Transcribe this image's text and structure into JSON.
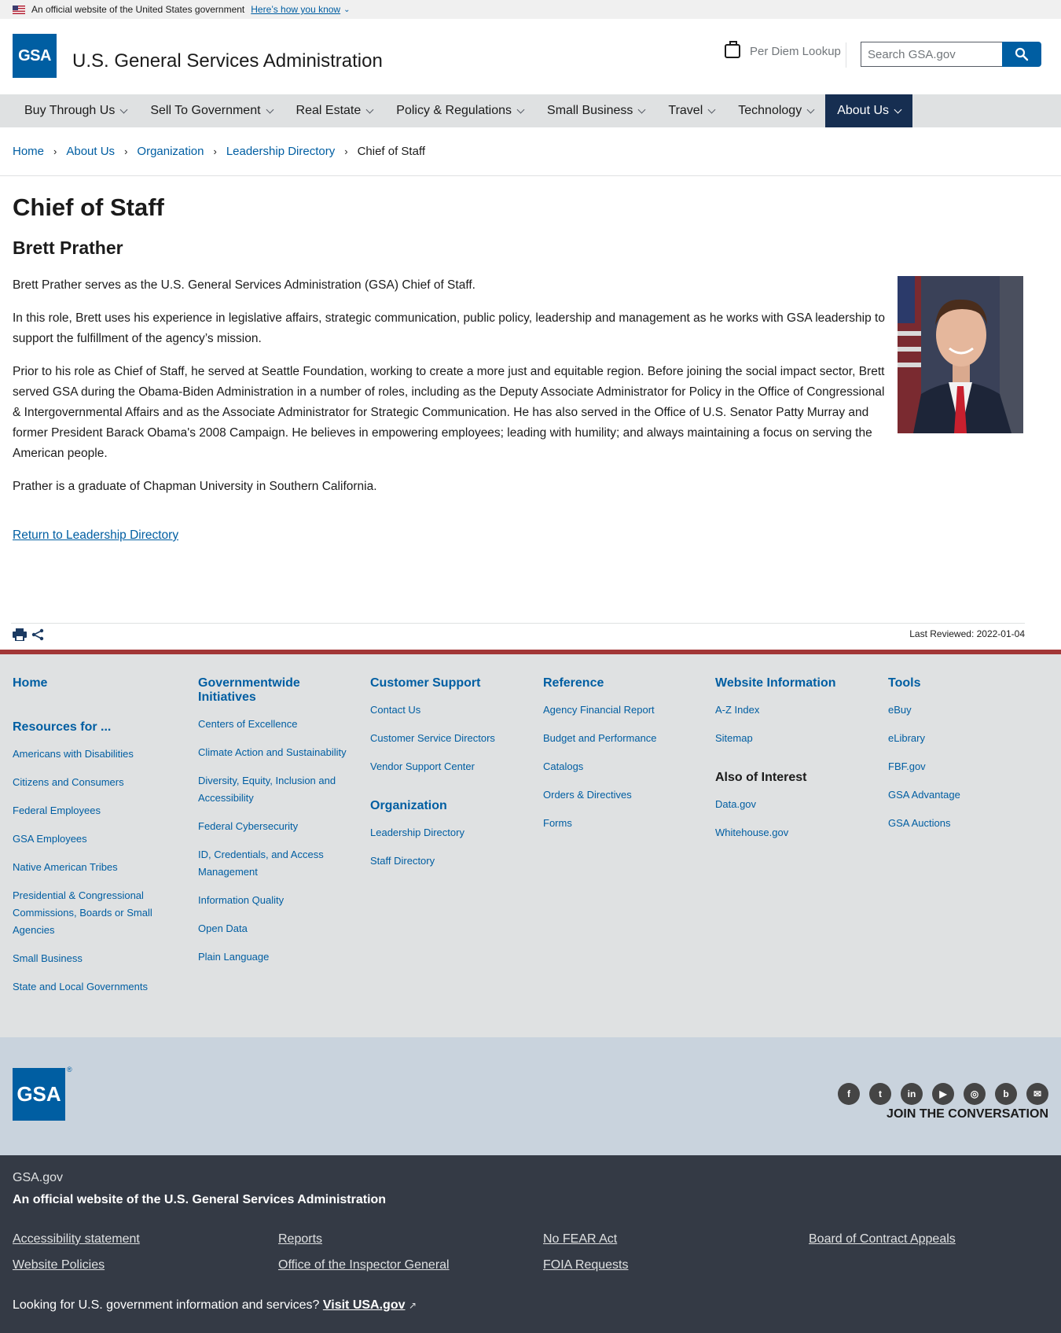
{
  "gov_banner": {
    "official_text": "An official website of the United States government",
    "how_you_know": "Here’s how you know"
  },
  "header": {
    "logo_text": "GSA",
    "site_title": "U.S. General Services Administration",
    "per_diem": "Per Diem Lookup",
    "search_placeholder": "Search GSA.gov"
  },
  "nav": {
    "items": [
      "Buy Through Us",
      "Sell To Government",
      "Real Estate",
      "Policy & Regulations",
      "Small Business",
      "Travel",
      "Technology",
      "About Us"
    ],
    "active": "About Us"
  },
  "breadcrumb": {
    "items": [
      "Home",
      "About Us",
      "Organization",
      "Leadership Directory"
    ],
    "current": "Chief of Staff"
  },
  "main": {
    "page_title": "Chief of Staff",
    "name": "Brett Prather",
    "paragraphs": [
      "Brett Prather serves as the U.S. General Services Administration (GSA) Chief of Staff.",
      "In this role, Brett uses his experience in legislative affairs, strategic communication, public policy, leadership and management as he works with GSA leadership to support the fulfillment of the agency’s mission.",
      "Prior to his role as Chief of Staff, he served at Seattle Foundation, working to create a more just and equitable region. Before joining the social impact sector, Brett served GSA during the Obama-Biden Administration in a number of roles, including as the Deputy Associate Administrator for Policy in the Office of Congressional & Intergovernmental Affairs and as the Associate Administrator for Strategic Communication. He has also served in the Office of U.S. Senator Patty Murray and former President Barack Obama's 2008 Campaign. He believes in empowering employees; leading with humility; and always maintaining a focus on serving the American people.",
      "Prather is a graduate of Chapman University in Southern California."
    ],
    "return_link": "Return to Leadership Directory",
    "last_reviewed": "Last Reviewed: 2022-01-04"
  },
  "footer": {
    "col1": {
      "home": "Home",
      "resources_head": "Resources for ...",
      "links": [
        "Americans with Disabilities",
        "Citizens and Consumers",
        "Federal Employees",
        "GSA Employees",
        "Native American Tribes",
        "Presidential & Congressional Commissions, Boards or Small Agencies",
        "Small Business",
        "State and Local Governments"
      ]
    },
    "col2": {
      "head": "Governmentwide Initiatives",
      "links": [
        "Centers of Excellence",
        "Climate Action and Sustainability",
        "Diversity, Equity, Inclusion and Accessibility",
        "Federal Cybersecurity",
        "ID, Credentials, and Access Management",
        "Information Quality",
        "Open Data",
        "Plain Language"
      ]
    },
    "col3": {
      "head": "Customer Support",
      "links": [
        "Contact Us",
        "Customer Service Directors",
        "Vendor Support Center"
      ],
      "head2": "Organization",
      "links2": [
        "Leadership Directory",
        "Staff Directory"
      ]
    },
    "col4": {
      "head": "Reference",
      "links": [
        "Agency Financial Report",
        "Budget and Performance",
        "Catalogs",
        "Orders & Directives",
        "Forms"
      ]
    },
    "col5": {
      "head": "Website Information",
      "links": [
        "A-Z Index",
        "Sitemap"
      ],
      "also_head": "Also of Interest",
      "also_links": [
        "Data.gov",
        "Whitehouse.gov"
      ]
    },
    "col6": {
      "head": "Tools",
      "links": [
        "eBuy",
        "eLibrary",
        "FBF.gov",
        "GSA Advantage",
        "GSA Auctions"
      ]
    },
    "logo_text": "GSA",
    "reg_mark": "®",
    "join": "JOIN THE CONVERSATION",
    "social_icons": [
      "facebook-icon",
      "twitter-icon",
      "linkedin-icon",
      "youtube-icon",
      "instagram-icon",
      "blog-icon",
      "email-icon"
    ],
    "site": "GSA.gov",
    "official": "An official website of the U.S. General Services Administration",
    "bottom_links": [
      "Accessibility statement",
      "Reports",
      "No FEAR Act",
      "Board of Contract Appeals",
      "Website Policies",
      "Office of the Inspector General",
      "FOIA Requests"
    ],
    "looking": "Looking for U.S. government information and services?",
    "visit": "Visit USA.gov"
  },
  "colors": {
    "primary": "#005ea2",
    "nav_active": "#162e51",
    "footer_accent": "#a23737",
    "footer_dark": "#343a45"
  }
}
